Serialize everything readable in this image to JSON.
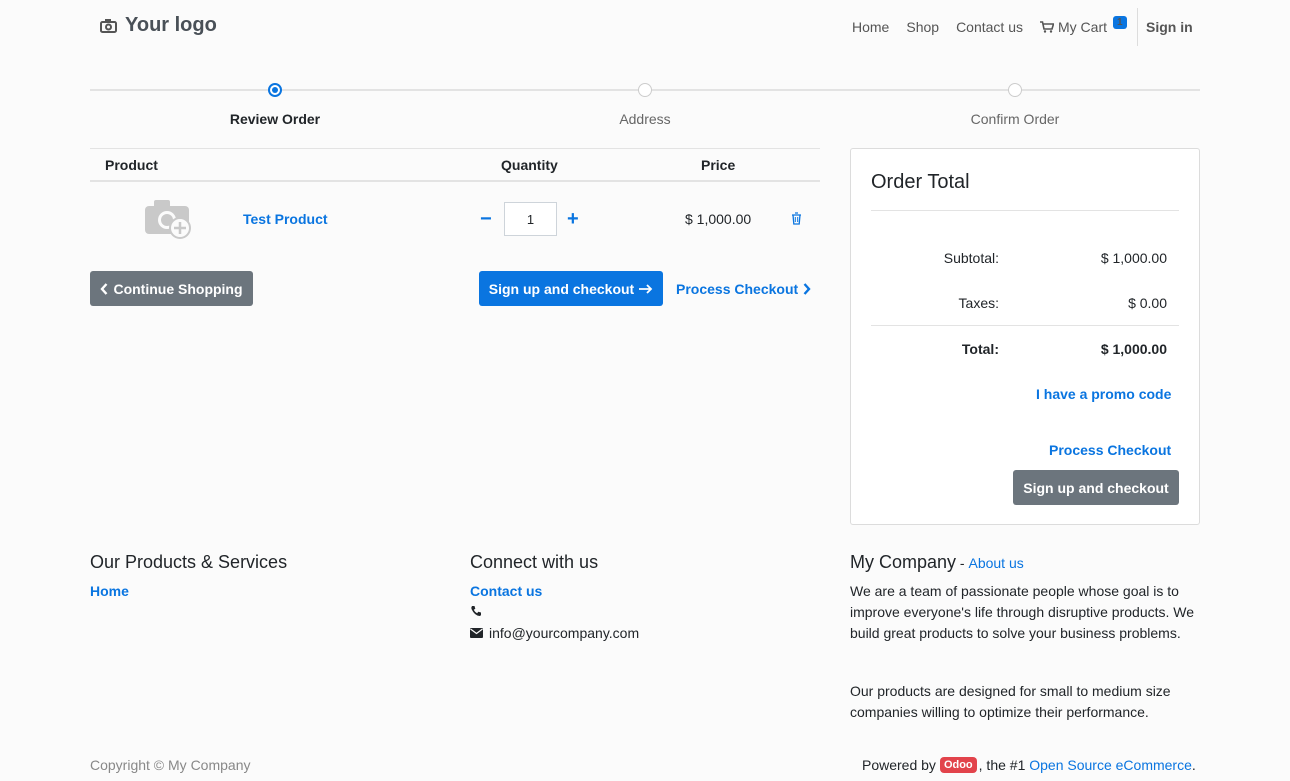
{
  "header": {
    "logo_text": "Your logo",
    "nav": {
      "home": "Home",
      "shop": "Shop",
      "contact": "Contact us",
      "cart": "My Cart",
      "cart_count": "1"
    },
    "signin": "Sign in"
  },
  "steps": [
    {
      "label": "Review Order",
      "active": true
    },
    {
      "label": "Address",
      "active": false
    },
    {
      "label": "Confirm Order",
      "active": false
    }
  ],
  "cart": {
    "columns": {
      "product": "Product",
      "quantity": "Quantity",
      "price": "Price"
    },
    "items": [
      {
        "name": "Test Product",
        "quantity": "1",
        "price": "$ 1,000.00"
      }
    ],
    "continue_label": "Continue Shopping",
    "signup_label": "Sign up and checkout",
    "process_label": "Process Checkout"
  },
  "order_total": {
    "title": "Order Total",
    "subtotal_label": "Subtotal:",
    "subtotal_value": "$ 1,000.00",
    "taxes_label": "Taxes:",
    "taxes_value": "$ 0.00",
    "total_label": "Total:",
    "total_value": "$ 1,000.00",
    "promo_label": "I have a promo code",
    "process_label": "Process Checkout",
    "signup_label": "Sign up and checkout"
  },
  "footer": {
    "col1": {
      "heading": "Our Products & Services",
      "link": "Home"
    },
    "col2": {
      "heading": "Connect with us",
      "link": "Contact us",
      "phone": "",
      "email": "info@yourcompany.com"
    },
    "col3": {
      "heading": "My Company",
      "separator": " - ",
      "about_link": "About us",
      "para1": "We are a team of passionate people whose goal is to improve everyone's life through disruptive products. We build great products to solve your business problems.",
      "para2": "Our products are designed for small to medium size companies willing to optimize their performance."
    },
    "copyright": "Copyright © My Company",
    "powered_by": "Powered by",
    "odoo_badge": "Odoo",
    "powered_mid": ", the #1",
    "powered_link": "Open Source eCommerce",
    "powered_end": "."
  },
  "colors": {
    "primary": "#0a75e0",
    "secondary": "#6c757d",
    "odoo": "#e2434b"
  }
}
